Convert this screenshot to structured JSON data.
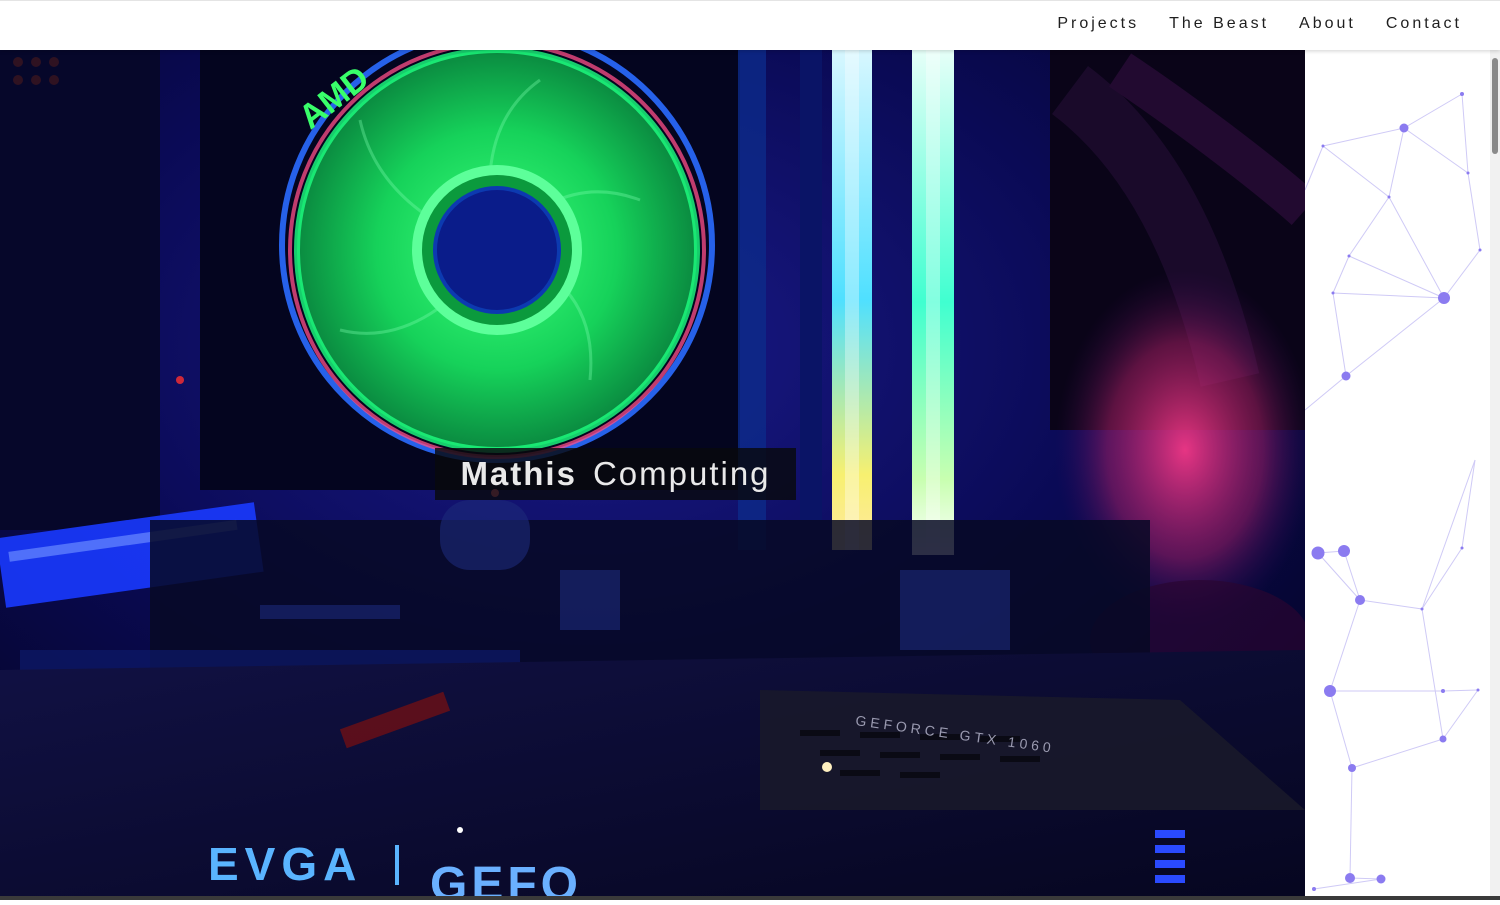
{
  "nav": {
    "links": [
      "Projects",
      "The Beast",
      "About",
      "Contact"
    ]
  },
  "hero": {
    "title_bold": "Mathis",
    "title_rest": "Computing",
    "fan_brand": "AMD",
    "gpu_brand": "EVGA",
    "gpu_model_partial": "GEFO",
    "gpu_label": "GEFORCE GTX 1060"
  },
  "colors": {
    "nav_bg": "#ffffff",
    "nav_text": "#1f1f1f",
    "title_bg": "#0a0c0e",
    "title_text": "#e9e9e9",
    "network_dot": "#8b7bf0",
    "network_line": "#c9c4f5"
  }
}
